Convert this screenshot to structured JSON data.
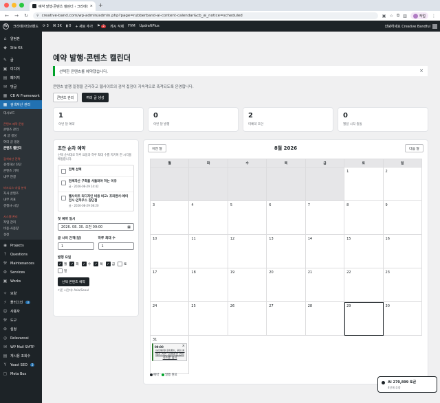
{
  "browser": {
    "tab_title": "예약 발행·콘텐츠 캘린더 ‹ 크리에이...",
    "url": "creative-band.com/wp-admin/admin.php?page=rubberband-ai-content-calendar&cb_ai_notice=scheduled",
    "profile_label": "작업"
  },
  "adminbar": {
    "site_name": "크리에이티브밴드",
    "updates_count": "3",
    "plugin_count": "3K",
    "comments_count": "0",
    "new_label": "+ 새로 추가",
    "notif_count": "2",
    "delete_post": "게시 삭제",
    "fvm": "FVM",
    "updraft": "UpdraftPlus",
    "greeting": "안녕하세요 Creative Bandful"
  },
  "sidebar": {
    "top": [
      {
        "icon": "⌂",
        "label": "알림판"
      },
      {
        "icon": "◆",
        "label": "Site Kit"
      }
    ],
    "mid": [
      {
        "icon": "✎",
        "label": "글"
      },
      {
        "icon": "▣",
        "label": "미디어"
      },
      {
        "icon": "▤",
        "label": "페이지"
      },
      {
        "icon": "✉",
        "label": "댓글"
      },
      {
        "icon": "▦",
        "label": "CB AI Framework"
      }
    ],
    "active": {
      "icon": "▦",
      "label": "검색자산 관리"
    },
    "submenu": [
      "대시보드",
      "",
      "콘텐츠 제작 운영",
      "콘텐츠 관리",
      "새 글 생성",
      "여러 글 생성",
      "콘텐츠 캘린더",
      "",
      "검색자산 전략",
      "검색자산 진단",
      "콘텐츠 기획",
      "내부 연결",
      "",
      "비즈니스·사업 분석",
      "자사 콘텐츠",
      "내부 지표",
      "경쟁사·시장",
      "",
      "시스템 관리",
      "작업 관리",
      "비용·사용량",
      "설정"
    ],
    "lower": [
      {
        "icon": "◉",
        "label": "Projects"
      },
      {
        "icon": "?",
        "label": "Questions"
      },
      {
        "icon": "⚒",
        "label": "Maintenances"
      },
      {
        "icon": "⚙",
        "label": "Services"
      },
      {
        "icon": "▣",
        "label": "Works"
      }
    ],
    "bottom": [
      {
        "icon": "✧",
        "label": "모양"
      },
      {
        "icon": "⚡",
        "label": "플러그인",
        "badge": "3"
      },
      {
        "icon": "☺",
        "label": "사용자"
      },
      {
        "icon": "⚒",
        "label": "도구"
      },
      {
        "icon": "⚙",
        "label": "설정"
      },
      {
        "icon": "◎",
        "label": "Relevanssi"
      },
      {
        "icon": "✉",
        "label": "WP Mail SMTP"
      },
      {
        "icon": "▤",
        "label": "게시용 조회수"
      },
      {
        "icon": "Y",
        "label": "Yoast SEO",
        "badge": "2"
      },
      {
        "icon": "▢",
        "label": "Meta Box"
      }
    ]
  },
  "page": {
    "title": "예약 발행·콘텐츠 캘린더",
    "notice": "선택한 콘텐츠를 예약했습니다.",
    "description": "콘텐츠 발행 일정을 관리하고 웹사이트의 검색 접점이 지속적으로 축적되도록 운영합니다.",
    "btn_manage": "콘텐츠 관리",
    "btn_generate": "여러 글 생성"
  },
  "stats": [
    {
      "value": "1",
      "label": "이번 달 예약"
    },
    {
      "value": "0",
      "label": "이번 달 발행"
    },
    {
      "value": "2",
      "label": "미예약 초안"
    },
    {
      "value": "0",
      "label": "월일 시각 충돌"
    }
  ],
  "panel": {
    "title": "초안 순차 예약",
    "desc": "선택 순서대로 하루 요일과 하루 최대 수를 지키며 한 시각을 배정합니다.",
    "select_all": "전체 선택",
    "drafts": [
      {
        "title": "검색자산 구축을 서둘러야 하는 이유",
        "meta": "글 · 2026-08-29 14:42"
      },
      {
        "title": "웹사이트 리디자인 비용 비교: 프리랜서·에이전시·인하우스 장단점",
        "meta": "글 · 2026-08-29 08:20"
      }
    ],
    "first_label": "첫 예약 일시",
    "first_value": "2026. 08. 30. 오전 09:00",
    "interval_label": "글 사이 간격(일)",
    "interval_value": "1",
    "perday_label": "하루 최대 수",
    "perday_value": "1",
    "weekday_label": "발행 요일",
    "weekdays": [
      {
        "label": "월",
        "on": true
      },
      {
        "label": "화",
        "on": true
      },
      {
        "label": "수",
        "on": true
      },
      {
        "label": "목",
        "on": true
      },
      {
        "label": "금",
        "on": true
      },
      {
        "label": "토",
        "on": false
      },
      {
        "label": "일",
        "on": false
      }
    ],
    "run_button": "선택 콘텐츠 예약",
    "timezone": "기준 시간대: Asia/Seoul"
  },
  "calendar": {
    "prev": "이전 달",
    "next": "다음 달",
    "month": "8월 2026",
    "weekdays": [
      "월",
      "화",
      "수",
      "목",
      "금",
      "토",
      "일"
    ],
    "lead_blanks": 5,
    "days_in_month": 31,
    "today": 29,
    "event_day": 31,
    "event": {
      "time": "09:00",
      "title": "크리에이티브밴드, 워드프레스 기반 '검색자산 관리 시스템' 출시"
    },
    "legend_scheduled": "예약",
    "legend_published": "발행 완료",
    "scheduled_color": "#1d2327",
    "published_color": "#00a32a"
  },
  "ai_toast": {
    "title": "AI 270,899 토큰",
    "sub": "4단계 추정"
  }
}
